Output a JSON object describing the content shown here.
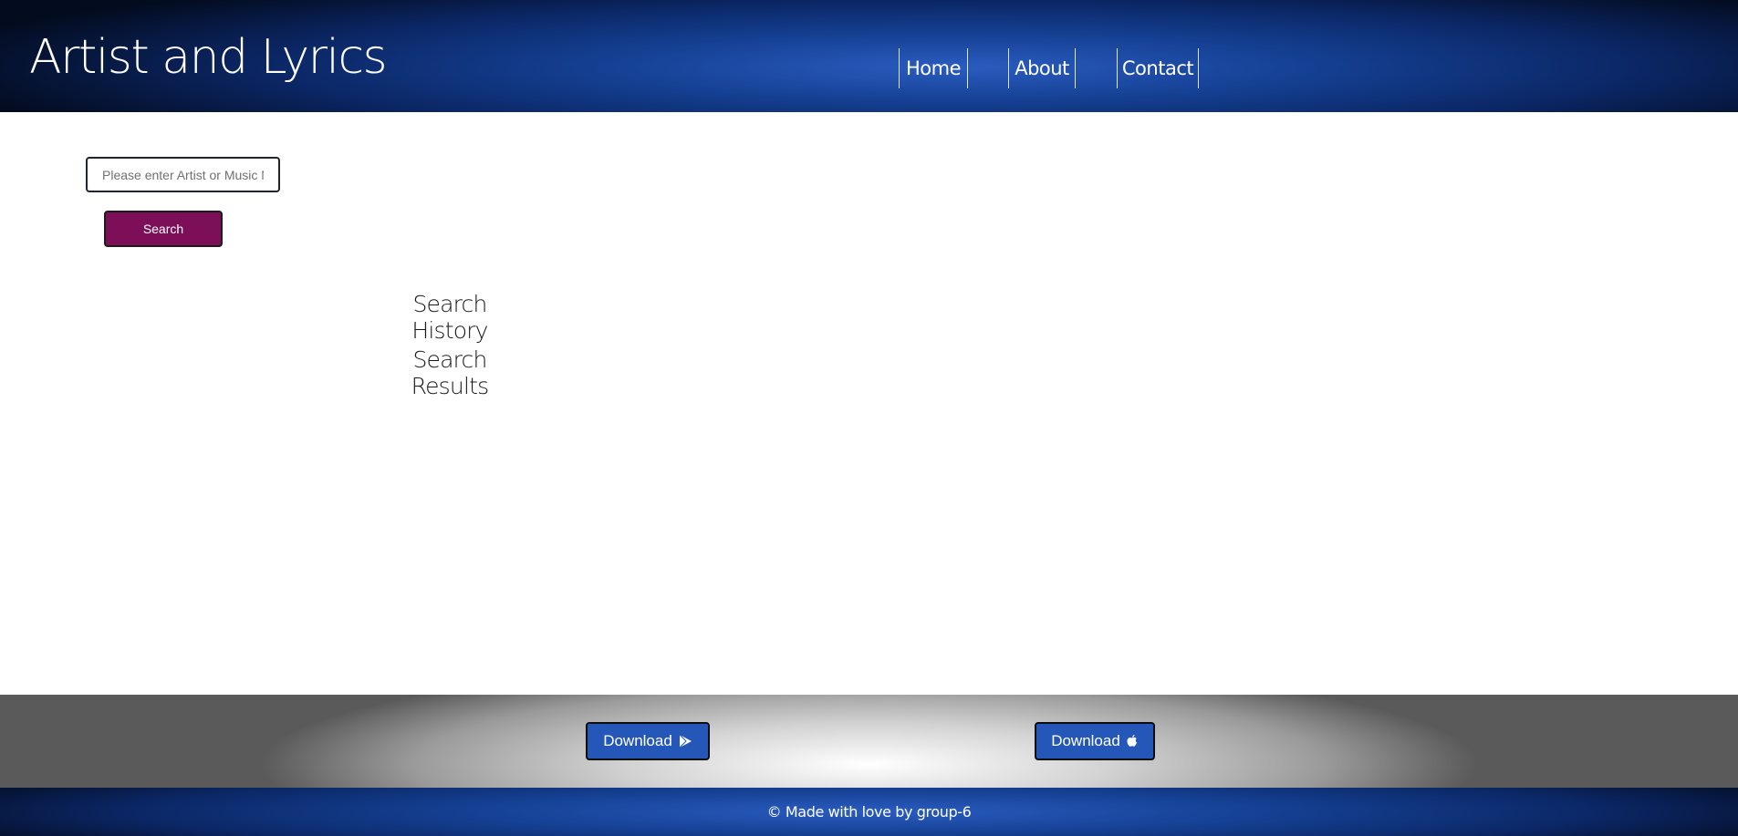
{
  "header": {
    "brand": "Artist and Lyrics",
    "nav": [
      {
        "label": "Home"
      },
      {
        "label": "About"
      },
      {
        "label": "Contact"
      }
    ]
  },
  "search": {
    "placeholder": "Please enter Artist or Music Name",
    "value": "",
    "button_label": "Search"
  },
  "sections": {
    "history_title": "Search History",
    "results_title": "Search Results"
  },
  "downloads": [
    {
      "label": "Download",
      "icon": "play-store-icon"
    },
    {
      "label": "Download",
      "icon": "apple-icon"
    }
  ],
  "footer": {
    "text": "© Made with love by group-6"
  },
  "colors": {
    "header_blue": "#143f91",
    "search_button": "#7d0f58",
    "download_button": "#2457b8"
  }
}
